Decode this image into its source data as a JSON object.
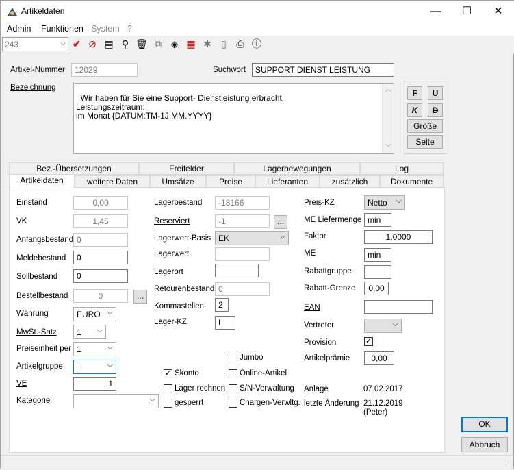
{
  "window": {
    "title": "Artikeldaten",
    "minimize": "—",
    "maximize": "☐",
    "close": "✕"
  },
  "menu": [
    "Admin",
    "Funktionen",
    "System",
    "?"
  ],
  "toolbar": {
    "record": "243",
    "icons": [
      "checkmark-icon",
      "cancel-icon",
      "record-icon",
      "search-icon",
      "trash-icon",
      "copy-icon",
      "eraser-icon",
      "print-preview-icon",
      "debug-icon",
      "document-search-icon",
      "printer-icon",
      "help-icon"
    ]
  },
  "header": {
    "artikelnummer_label": "Artikel-Nummer",
    "artikelnummer": "12029",
    "suchwort_label": "Suchwort",
    "suchwort": "SUPPORT  DIENST LEISTUNG",
    "bezeichnung_label": "Bezeichnung",
    "bezeichnung": "Wir haben für Sie eine Support- Dienstleistung erbracht.\nLeistungszeitraum:\nim Monat {DATUM:TM-1J:MM.YYYY}",
    "fmt": {
      "bold": "F",
      "underline": "U",
      "italic": "K",
      "strike": "D",
      "size": "Größe",
      "page": "Seite"
    }
  },
  "tabs_back": [
    "Bez.-Übersetzungen",
    "Freifelder",
    "Lagerbewegungen",
    "Log"
  ],
  "tabs_front": [
    "Artikeldaten",
    "weitere Daten",
    "Umsätze",
    "Preise",
    "Lieferanten",
    "zusätzlich",
    "Dokumente"
  ],
  "col1": {
    "einstand_label": "Einstand",
    "einstand": "0,00",
    "vk_label": "VK",
    "vk": "1,45",
    "anfangsbestand_label": "Anfangsbestand",
    "anfangsbestand": "0",
    "meldebestand_label": "Meldebestand",
    "meldebestand": "0",
    "sollbestand_label": "Sollbestand",
    "sollbestand": "0",
    "bestellbestand_label": "Bestellbestand",
    "bestellbestand": "0",
    "waehrung_label": "Währung",
    "waehrung": "EURO",
    "mwst_label": "MwSt.-Satz",
    "mwst": "1",
    "preiseinheit_label": "Preiseinheit per",
    "preiseinheit": "1",
    "artikelgruppe_label": "Artikelgruppe",
    "artikelgruppe": "",
    "ve_label": "VE",
    "ve": "1",
    "kategorie_label": "Kategorie",
    "kategorie": ""
  },
  "col2": {
    "lagerbestand_label": "Lagerbestand",
    "lagerbestand": "-18166",
    "reserviert_label": "Reserviert",
    "reserviert": "-1",
    "lagerwertbasis_label": "Lagerwert-Basis",
    "lagerwertbasis": "EK",
    "lagerwert_label": "Lagerwert",
    "lagerwert": "",
    "lagerort_label": "Lagerort",
    "lagerort": "",
    "retourenbestand_label": "Retourenbestand",
    "retourenbestand": "0",
    "kommastellen_label": "Kommastellen",
    "kommastellen": "2",
    "lagerkz_label": "Lager-KZ",
    "lagerkz": "L"
  },
  "col3": {
    "preiskz_label": "Preis-KZ",
    "preiskz": "Netto",
    "meliefermenge_label": "ME Liefermenge",
    "meliefermenge": "min",
    "faktor_label": "Faktor",
    "faktor": "1,0000",
    "me_label": "ME",
    "me": "min",
    "rabattgruppe_label": "Rabattgruppe",
    "rabattgruppe": "",
    "rabattgrenze_label": "Rabatt-Grenze",
    "rabattgrenze": "0,00",
    "ean_label": "EAN",
    "ean": "",
    "vertreter_label": "Vertreter",
    "vertreter": "",
    "provision_label": "Provision",
    "artikelpraemie_label": "Artikelprämie",
    "artikelpraemie": "0,00",
    "anlage_label": "Anlage",
    "anlage": "07.02.2017",
    "letzte_label": "letzte Änderung",
    "letzte": "21.12.2019",
    "letzte_user": "(Peter)"
  },
  "checks": {
    "jumbo": "Jumbo",
    "skonto": "Skonto",
    "online": "Online-Artikel",
    "lager_rechnen": "Lager rechnen",
    "sn": "S/N-Verwaltung",
    "gesperrt": "gesperrt",
    "chargen": "Chargen-Verwltg."
  },
  "buttons": {
    "ok": "OK",
    "abbruch": "Abbruch",
    "ellipsis": "..."
  }
}
